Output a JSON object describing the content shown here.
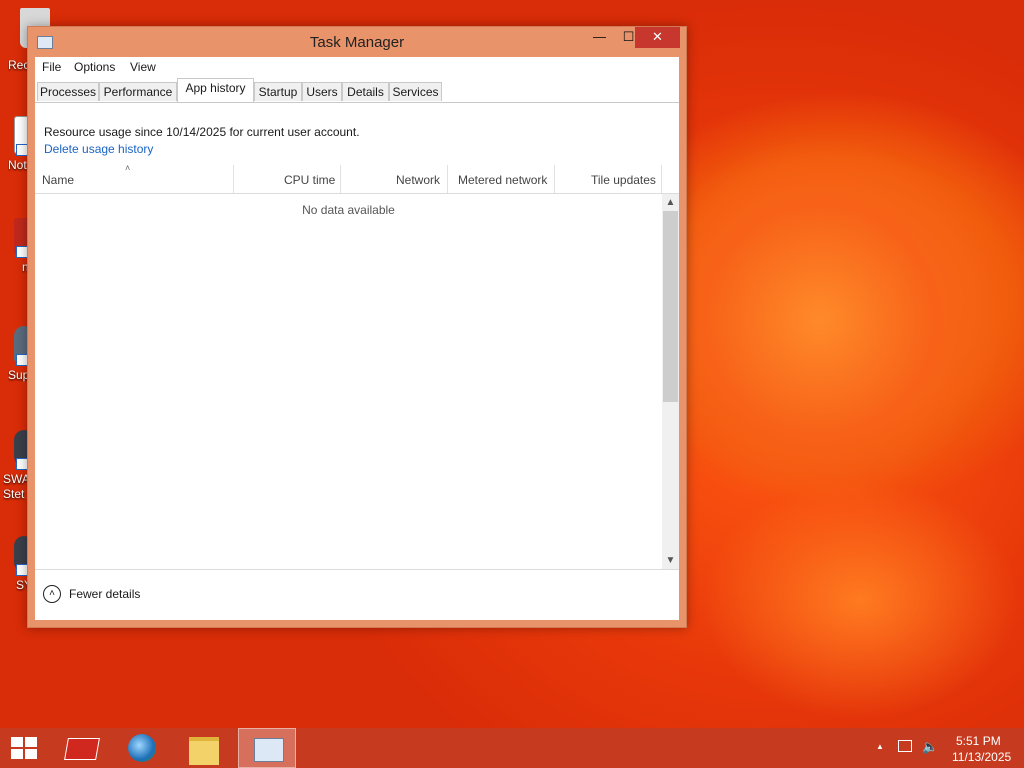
{
  "desktop": {
    "icons": [
      {
        "label": "Rec"
      },
      {
        "label": "Not"
      },
      {
        "label": "n"
      },
      {
        "label": "Sup"
      },
      {
        "label": "SWA\nStet"
      },
      {
        "label": "SY"
      }
    ]
  },
  "window": {
    "title": "Task Manager",
    "controls": {
      "minimize": "—",
      "maximize": "☐",
      "close": "✕"
    },
    "menu": [
      "File",
      "Options",
      "View"
    ],
    "tabs": [
      {
        "label": "Processes",
        "active": false
      },
      {
        "label": "Performance",
        "active": false
      },
      {
        "label": "App history",
        "active": true
      },
      {
        "label": "Startup",
        "active": false
      },
      {
        "label": "Users",
        "active": false
      },
      {
        "label": "Details",
        "active": false
      },
      {
        "label": "Services",
        "active": false
      }
    ],
    "info_text": "Resource usage since 10/14/2025 for current user account.",
    "delete_link": "Delete usage history",
    "columns": [
      "Name",
      "CPU time",
      "Network",
      "Metered network",
      "Tile updates"
    ],
    "sort_indicator": "˄",
    "empty_message": "No data available",
    "footer_button": "Fewer details"
  },
  "taskbar": {
    "apps": [
      {
        "name": "start-button"
      },
      {
        "name": "red-app"
      },
      {
        "name": "browser"
      },
      {
        "name": "file-explorer"
      },
      {
        "name": "task-manager",
        "active": true
      }
    ],
    "tray": {
      "chevron": "▲",
      "time": "5:51 PM",
      "date": "11/13/2025"
    }
  },
  "colors": {
    "accent": "#e9936b",
    "taskbar": "#c63a1f",
    "close": "#c7372e",
    "link": "#1b64c4",
    "desktop": "#e8380a"
  }
}
